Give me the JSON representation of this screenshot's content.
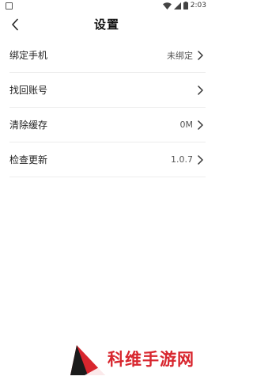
{
  "status_bar": {
    "time": "2:03",
    "icons": [
      "app-notification-icon",
      "wifi-icon",
      "signal-icon",
      "battery-icon"
    ]
  },
  "header": {
    "title": "设置",
    "back_icon": "chevron-left-icon"
  },
  "settings": [
    {
      "label": "绑定手机",
      "value": "未绑定"
    },
    {
      "label": "找回账号",
      "value": ""
    },
    {
      "label": "清除缓存",
      "value": "0M"
    },
    {
      "label": "检查更新",
      "value": "1.0.7"
    }
  ],
  "watermark": {
    "text": "科维手游网",
    "color": "#d8262e"
  }
}
